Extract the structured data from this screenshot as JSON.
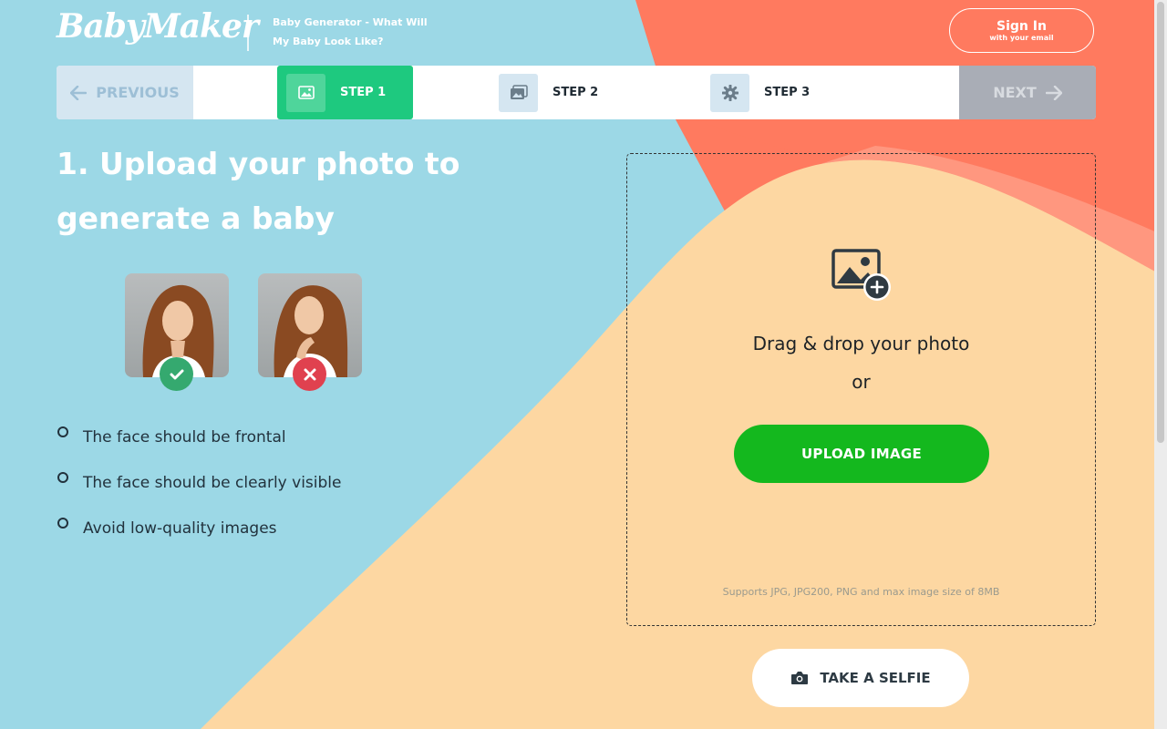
{
  "header": {
    "logo": "BabyMaker",
    "tagline": "Baby Generator - What Will My Baby Look Like?",
    "signin_label": "Sign In",
    "signin_sub": "with your email"
  },
  "stepbar": {
    "previous_label": "PREVIOUS",
    "next_label": "NEXT",
    "steps": [
      {
        "label": "STEP 1",
        "icon": "image-icon",
        "active": true
      },
      {
        "label": "STEP 2",
        "icon": "images-icon",
        "active": false
      },
      {
        "label": "STEP 3",
        "icon": "gear-icon",
        "active": false
      }
    ]
  },
  "main": {
    "heading": "1. Upload your photo to generate a baby",
    "examples": [
      {
        "status": "good",
        "icon": "check-icon"
      },
      {
        "status": "bad",
        "icon": "close-icon"
      }
    ],
    "rules": [
      "The face should be frontal",
      "The face should be clearly visible",
      "Avoid low-quality images"
    ]
  },
  "upload": {
    "drag_text": "Drag & drop your photo",
    "or_text": "or",
    "button_label": "UPLOAD IMAGE",
    "supports": "Supports JPG, JPG200, PNG and max image size of 8MB",
    "selfie_label": "TAKE A SELFIE"
  },
  "colors": {
    "sky": "#9cd8e6",
    "coral": "#ff7a5f",
    "peach": "#fdd7a2",
    "step_active": "#1ec97f",
    "upload_green": "#14b81e"
  }
}
